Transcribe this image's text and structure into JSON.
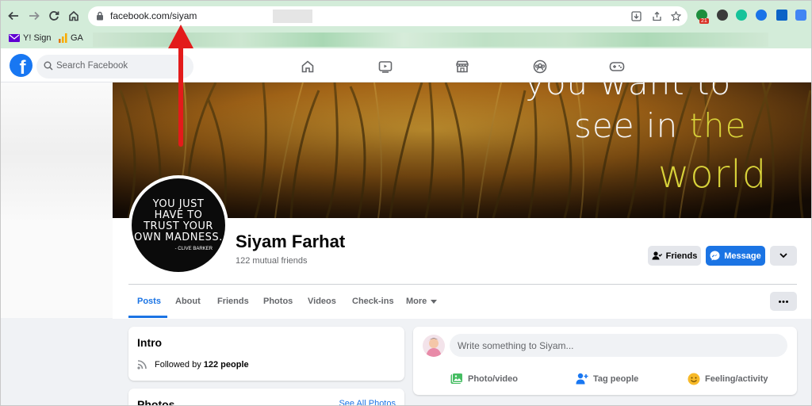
{
  "browser": {
    "url": "facebook.com/siyam",
    "ext_badge": "21"
  },
  "bookmarks": {
    "items": [
      {
        "label": "Y! Sign"
      },
      {
        "label": "GA"
      }
    ]
  },
  "fb_header": {
    "logo": "f",
    "search_placeholder": "Search Facebook",
    "nav_icons": [
      "home-icon",
      "watch-icon",
      "marketplace-icon",
      "groups-icon",
      "gaming-icon"
    ]
  },
  "cover": {
    "line1": "you want to",
    "line2_a": "see in ",
    "line2_b": "the",
    "line3": "world",
    "accent_color": "#d8d23a"
  },
  "avatar": {
    "quote_lines": [
      "YOU JUST",
      "HAVE TO",
      "TRUST YOUR",
      "OWN MADNESS."
    ],
    "author": "- CLIVE BARKER"
  },
  "profile": {
    "name": "Siyam Farhat",
    "mutual_friends": "122 mutual friends"
  },
  "actions": {
    "friends": "Friends",
    "message": "Message"
  },
  "tabs": [
    {
      "label": "Posts"
    },
    {
      "label": "About"
    },
    {
      "label": "Friends"
    },
    {
      "label": "Photos"
    },
    {
      "label": "Videos"
    },
    {
      "label": "Check-ins"
    },
    {
      "label": "More"
    }
  ],
  "intro": {
    "title": "Intro",
    "followed_prefix": "Followed by ",
    "followed_count": "122 people"
  },
  "photos": {
    "title": "Photos",
    "see_all": "See All Photos"
  },
  "composer": {
    "placeholder": "Write something to Siyam...",
    "photo_video": "Photo/video",
    "tag_people": "Tag people",
    "feeling": "Feeling/activity"
  },
  "colors": {
    "fb_blue": "#1877f2",
    "browser_green": "#d3ecd9",
    "arrow_red": "#e31b1b"
  }
}
